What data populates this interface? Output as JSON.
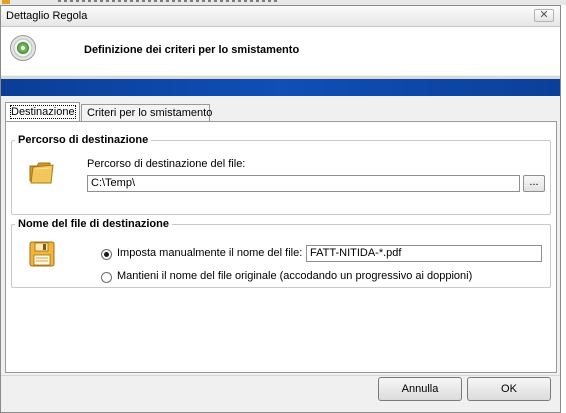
{
  "window": {
    "title": "Dettaglio Regola",
    "close_glyph": "✕"
  },
  "header": {
    "icon": "disc-gear-icon",
    "title": "Definizione dei criteri per lo smistamento"
  },
  "tabs": [
    {
      "label": "Destinazione",
      "active": true
    },
    {
      "label": "Criteri per lo smistamento",
      "active": false
    }
  ],
  "destination": {
    "group_title": "Percorso di destinazione",
    "icon": "folder-icon",
    "field_label": "Percorso di destinazione del file:",
    "path_value": "C:\\Temp\\",
    "browse_label": "..."
  },
  "filename": {
    "group_title": "Nome del file di destinazione",
    "icon": "floppy-disk-icon",
    "option_manual_label": "Imposta manualmente il nome del file:",
    "option_manual_selected": true,
    "manual_value": "FATT-NITIDA-*.pdf",
    "option_keep_label": "Mantieni il nome del file originale (accodando un progressivo ai doppioni)",
    "option_keep_selected": false
  },
  "buttons": {
    "cancel_label": "Annulla",
    "ok_label": "OK"
  },
  "colors": {
    "band": "#0f4fb6",
    "folder": "#e8b840",
    "floppy": "#f2b43a"
  }
}
